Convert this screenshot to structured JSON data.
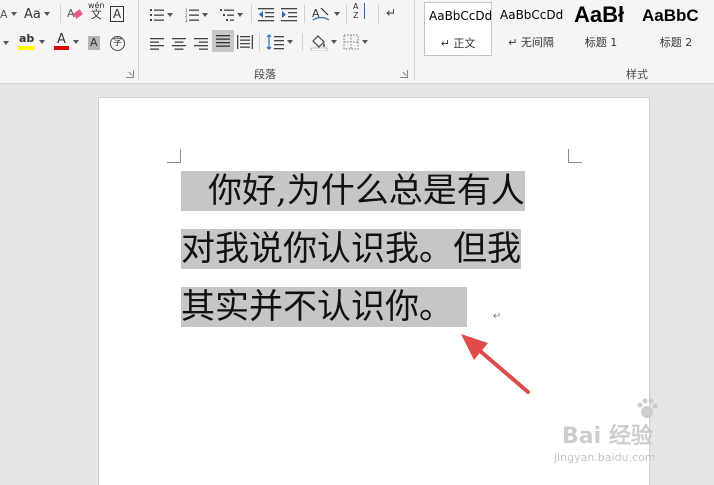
{
  "ribbon": {
    "font_size_btn": "Aa",
    "phonetic_top": "wén",
    "phonetic_bottom": "文",
    "char_border_letter": "A",
    "enclose_char": "字",
    "font_color_letter": "A",
    "highlight_letters": "ab",
    "char_shading_letter": "A",
    "sort_letters": "A Z",
    "paragraph_label": "段落",
    "styles_label": "样式",
    "styles": [
      {
        "sample": "AaBbCcDd",
        "name": "↵ 正文"
      },
      {
        "sample": "AaBbCcDd",
        "name": "↵ 无间隔"
      },
      {
        "sample": "AaBł",
        "name": "标题 1"
      },
      {
        "sample": "AaBbC",
        "name": "标题 2"
      }
    ]
  },
  "document": {
    "line1": "你好,为什么总是有人",
    "line2": "对我说你认识我。但我",
    "line3": "其实并不认识你。",
    "pilcrow": "↵"
  },
  "watermark": {
    "main": "Bai 经验",
    "sub": "jingyan.baidu.com"
  },
  "colors": {
    "selection": "#c6c6c6",
    "arrow": "#e04b4b",
    "highlight": "#ffff00",
    "font_color": "#e00000"
  }
}
